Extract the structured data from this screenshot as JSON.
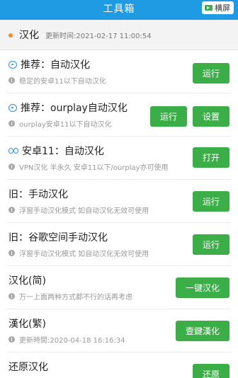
{
  "titlebar": {
    "title": "工具箱",
    "landscape_label": "横屏"
  },
  "header": {
    "title": "汉化",
    "update_time": "更新时间:2021-02-17 11:00:54"
  },
  "items": [
    {
      "title": "推荐：自动汉化",
      "desc": "稳定的安卓11以下自动汉化",
      "buttons": [
        "运行"
      ]
    },
    {
      "title": "推荐：ourplay自动汉化",
      "desc": "ourplay安卓11以下自动汉化",
      "buttons": [
        "运行",
        "设置"
      ]
    },
    {
      "title": "安卓11：自动汉化",
      "desc": "VPN汉化 半永久 安卓11以下/ourplay亦可使用",
      "buttons": [
        "打开"
      ]
    },
    {
      "title": "旧：手动汉化",
      "desc": "浮窗手动汉化模式 如自动汉化无效可使用",
      "buttons": [
        "运行"
      ]
    },
    {
      "title": "旧：谷歌空间手动汉化",
      "desc": "浮窗手动汉化模式 如自动汉化无效可使用",
      "buttons": [
        "运行"
      ]
    },
    {
      "title": "汉化(简)",
      "desc": "万一上面两种方式都不行的话再考虑",
      "buttons": [
        "一键汉化"
      ]
    },
    {
      "title": "漢化(繁)",
      "desc": "更新時間:2020-04-18 16:16:34",
      "buttons": [
        "壹鍵漢化"
      ]
    },
    {
      "title": "还原汉化",
      "desc": "",
      "buttons": [
        "还原"
      ]
    }
  ],
  "colors": {
    "titlebar": "#1e9be2",
    "button": "#3bae48",
    "dot": "#f08a2c",
    "icon_blue": "#2e8ee0"
  }
}
